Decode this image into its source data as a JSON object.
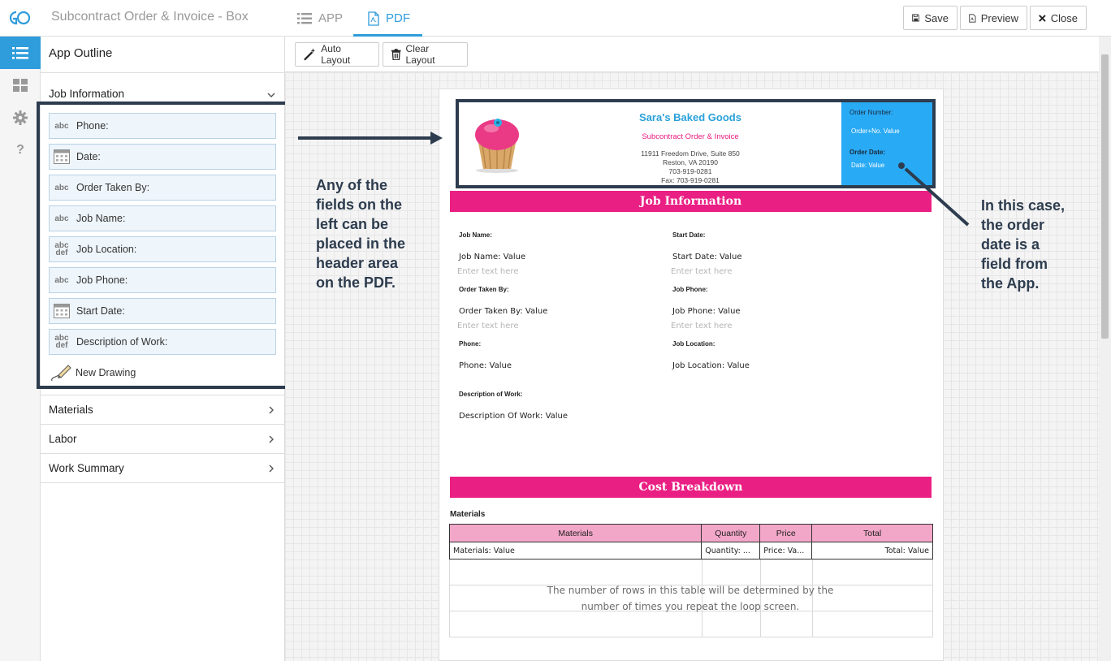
{
  "header": {
    "app_title": "Subcontract Order & Invoice - Box",
    "tabs": [
      {
        "label": "APP",
        "active": false
      },
      {
        "label": "PDF",
        "active": true
      }
    ],
    "buttons": {
      "save": "Save",
      "preview": "Preview",
      "close": "Close"
    }
  },
  "rail": {
    "items": [
      {
        "icon": "list-icon",
        "active": true
      },
      {
        "icon": "grid-icon",
        "active": false
      },
      {
        "icon": "gear-icon",
        "active": false
      },
      {
        "icon": "help-icon",
        "active": false
      }
    ]
  },
  "outline": {
    "title": "App Outline",
    "sections": [
      {
        "label": "Job Information",
        "expanded": true
      },
      {
        "label": "Materials",
        "expanded": false
      },
      {
        "label": "Labor",
        "expanded": false
      },
      {
        "label": "Work Summary",
        "expanded": false
      }
    ],
    "fields": [
      {
        "icon": "abc",
        "label": "Phone:"
      },
      {
        "icon": "calendar",
        "label": "Date:"
      },
      {
        "icon": "abc",
        "label": "Order Taken By:"
      },
      {
        "icon": "abc",
        "label": "Job Name:"
      },
      {
        "icon": "abcdef",
        "label": "Job Location:"
      },
      {
        "icon": "abc",
        "label": "Job Phone:"
      },
      {
        "icon": "calendar",
        "label": "Start Date:"
      },
      {
        "icon": "abcdef",
        "label": "Description of Work:"
      }
    ],
    "drawing_label": "New Drawing",
    "icon_text": {
      "abc": "abc",
      "def": "def"
    }
  },
  "toolbar": {
    "auto_layout": "Auto Layout",
    "clear_layout": "Clear Layout"
  },
  "pdf": {
    "company": "Sara's Baked Goods",
    "subtitle": "Subcontract Order & Invoice",
    "address": [
      "11911 Freedom Drive, Suite 850",
      "Reston, VA 20190",
      "703-919-0281",
      "Fax: 703-919-0281"
    ],
    "order_number_label": "Order Number:",
    "order_number_value": "Order+No. Value",
    "order_date_label": "Order Date:",
    "order_date_value": "Date: Value",
    "job_section": "Job Information",
    "placeholder": "Enter text here",
    "fields": {
      "job_name_label": "Job Name:",
      "job_name_value": "Job Name: Value",
      "start_date_label": "Start Date:",
      "start_date_value": "Start Date: Value",
      "order_taken_label": "Order Taken By:",
      "order_taken_value": "Order Taken By: Value",
      "job_phone_label": "Job Phone:",
      "job_phone_value": "Job Phone: Value",
      "phone_label": "Phone:",
      "phone_value": "Phone: Value",
      "job_location_label": "Job Location:",
      "job_location_value": "Job Location: Value",
      "description_label": "Description of Work:",
      "description_value": "Description Of Work: Value"
    },
    "cost_section": "Cost Breakdown",
    "materials_title": "Materials",
    "table": {
      "headers": [
        "Materials",
        "Quantity",
        "Price",
        "Total"
      ],
      "row": [
        "Materials: Value",
        "Quantity: ...",
        "Price: Va...",
        "Total: Value"
      ]
    },
    "loop_note_1": "The number of rows in this table will be determined by the",
    "loop_note_2": "number of times you repeat the loop screen."
  },
  "annotations": {
    "left": [
      "Any of the",
      "fields on the",
      "left can be",
      "placed in the",
      "header area",
      "on the PDF."
    ],
    "right": [
      "In this case,",
      "the order",
      "date is a",
      "field from",
      "the App."
    ]
  },
  "colors": {
    "accent": "#2f9cdb",
    "pink": "#ea1f84",
    "header_blue": "#29aaf5",
    "annotation": "#2d3c4e"
  }
}
